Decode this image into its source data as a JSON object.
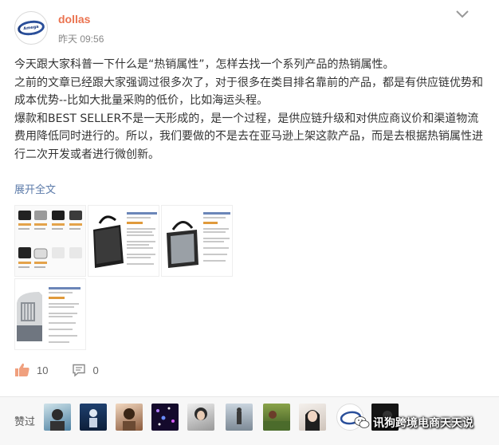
{
  "post": {
    "username": "dollas",
    "avatar_logo_text": "Amega",
    "timestamp": "昨天 09:56",
    "paragraphs": [
      "今天跟大家科普一下什么是“热销属性”，怎样去找一个系列产品的热销属性。",
      "之前的文章已经跟大家强调过很多次了，对于很多在类目排名靠前的产品，都是有供应链优势和成本优势--比如大批量采购的低价，比如海运头程。",
      "爆款和BEST SELLER不是一天形成的，是一个过程，是供应链升级和对供应商议价和渠道物流费用降低同时进行的。所以，我们要做的不是去在亚马逊上架这款产品，而是去根据热销属性进行二次开发或者进行微创新。"
    ],
    "expand_label": "展开全文",
    "thumbnails": [
      {
        "name": "pet-carrier-product-grid"
      },
      {
        "name": "black-pet-carrier-listing"
      },
      {
        "name": "gray-pet-carrier-listing"
      },
      {
        "name": "pet-kennel-listing"
      }
    ],
    "actions": {
      "likes": "10",
      "comments": "0"
    },
    "icons": {
      "like": "thumbs-up-icon",
      "comment": "comment-icon",
      "menu": "chevron-down-icon"
    }
  },
  "likes_bar": {
    "label": "赞过",
    "liker_count": 9
  },
  "watermark": {
    "text": "讯狗跨境电商天天说"
  },
  "colors": {
    "username": "#eb7350",
    "link": "#5b7aa9",
    "like_icon": "#f0a07e",
    "text": "#333333",
    "meta": "#888888"
  }
}
